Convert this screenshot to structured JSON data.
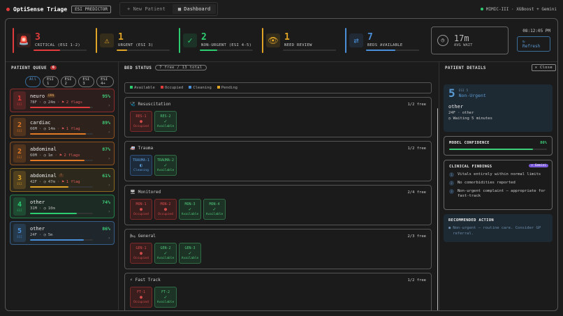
{
  "app": {
    "title": "OptiSense Triage",
    "badge": "ESI PREDICTOR",
    "nav": [
      {
        "label": "+ New Patient"
      },
      {
        "label": "Dashboard"
      }
    ],
    "model": "MIMIC-III · XGBoost + Gemini"
  },
  "stats": [
    {
      "num": "3",
      "label": "CRITICAL (ESI 1-2)",
      "color": "#e23b3b",
      "icon": "siren-icon",
      "glyph": "🚨",
      "progress": 0.5
    },
    {
      "num": "1",
      "label": "URGENT (ESI 3)",
      "color": "#e0a526",
      "icon": "warning-icon",
      "glyph": "⚠",
      "progress": 0.2
    },
    {
      "num": "2",
      "label": "NON-URGENT (ESI 4-5)",
      "color": "#2ecc71",
      "icon": "check-icon",
      "glyph": "✓",
      "progress": 0.33
    },
    {
      "num": "1",
      "label": "NEED REVIEW",
      "color": "#e0a526",
      "icon": "eye-icon",
      "glyph": "👁",
      "progress": 0
    },
    {
      "num": "7",
      "label": "BEDS AVAILABLE",
      "color": "#4a90d9",
      "icon": "transfer-icon",
      "glyph": "⇄",
      "progress": 0.55
    }
  ],
  "avg_wait": {
    "value": "17m",
    "label": "AVG WAIT"
  },
  "clock": "08:12:05 PM",
  "refresh": "↻ Refresh",
  "queue": {
    "title": "PATIENT QUEUE",
    "count": "6",
    "filters": [
      "All",
      "ESI 1",
      "ESI 2",
      "ESI 3",
      "ESI 4+"
    ],
    "patients": [
      {
        "esi": "1",
        "cc": "neuro",
        "tag": "DRN",
        "demo": "78F",
        "wait": "24m",
        "flags": "2 flags",
        "pct": "95%",
        "color": "#e23b3b"
      },
      {
        "esi": "2",
        "cc": "cardiac",
        "tag": "",
        "demo": "66M",
        "wait": "14m",
        "flags": "1 flag",
        "pct": "89%",
        "color": "#e07a26"
      },
      {
        "esi": "2",
        "cc": "abdominal",
        "tag": "",
        "demo": "60M",
        "wait": "1m",
        "flags": "2 flags",
        "pct": "87%",
        "color": "#e07a26"
      },
      {
        "esi": "3",
        "cc": "abdominal",
        "tag": "!",
        "demo": "42F",
        "wait": "47m",
        "flags": "1 flag",
        "pct": "61%",
        "color": "#e0a526"
      },
      {
        "esi": "4",
        "cc": "other",
        "tag": "",
        "demo": "31M",
        "wait": "10m",
        "flags": "",
        "pct": "74%",
        "color": "#2ecc71"
      },
      {
        "esi": "5",
        "cc": "other",
        "tag": "",
        "demo": "24F",
        "wait": "5m",
        "flags": "",
        "pct": "86%",
        "color": "#4a90d9"
      }
    ]
  },
  "beds": {
    "title": "BED STATUS",
    "summary": "7 free / 13 total",
    "legend": [
      "Available",
      "Occupied",
      "Cleaning",
      "Pending"
    ],
    "zones": [
      {
        "name": "Resuscitation",
        "free": "1/2 free",
        "icon": "wrench-icon",
        "beds": [
          {
            "id": "RES-1",
            "s": "Occupied"
          },
          {
            "id": "RES-2",
            "s": "Available"
          }
        ]
      },
      {
        "name": "Trauma",
        "free": "1/2 free",
        "icon": "ambulance-icon",
        "beds": [
          {
            "id": "TRAUMA-1",
            "s": "Cleaning"
          },
          {
            "id": "TRAUMA-2",
            "s": "Available"
          }
        ]
      },
      {
        "name": "Monitored",
        "free": "2/4 free",
        "icon": "monitor-icon",
        "beds": [
          {
            "id": "MON-1",
            "s": "Occupied"
          },
          {
            "id": "MON-2",
            "s": "Occupied"
          },
          {
            "id": "MON-3",
            "s": "Available"
          },
          {
            "id": "MON-4",
            "s": "Available"
          }
        ]
      },
      {
        "name": "General",
        "free": "2/3 free",
        "icon": "bed-icon",
        "beds": [
          {
            "id": "GEN-1",
            "s": "Occupied"
          },
          {
            "id": "GEN-2",
            "s": "Available"
          },
          {
            "id": "GEN-3",
            "s": "Available"
          }
        ]
      },
      {
        "name": "Fast Track",
        "free": "1/2 free",
        "icon": "bolt-icon",
        "beds": [
          {
            "id": "FT-1",
            "s": "Occupied"
          },
          {
            "id": "FT-2",
            "s": "Available"
          }
        ]
      }
    ]
  },
  "details": {
    "title": "PATIENT DETAILS",
    "close": "✕ Close",
    "esi": "5",
    "esi_label": "ESI 5",
    "category": "Non-Urgent",
    "cc": "other",
    "demo": "24F · other",
    "waiting": "Waiting 5 minutes",
    "confidence": {
      "label": "MODEL CONFIDENCE",
      "value": "86%",
      "fraction": 0.86
    },
    "findings": {
      "label": "CLINICAL FINDINGS",
      "badge": "✦ Gemini",
      "items": [
        "Vitals entirely within normal limits",
        "No comorbidities reported",
        "Non-urgent complaint — appropriate for fast-track"
      ]
    },
    "action": {
      "label": "RECOMMENDED ACTION",
      "text": "Non-urgent — routine care. Consider GP referral."
    }
  }
}
